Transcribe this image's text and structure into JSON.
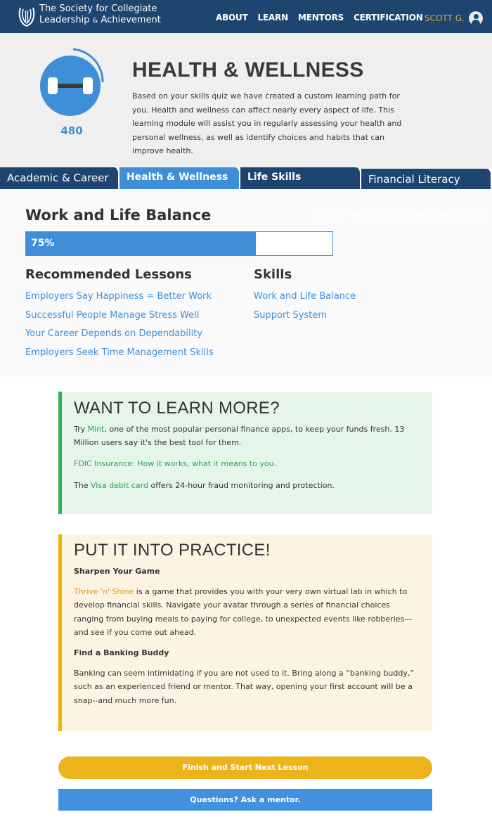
{
  "header": {
    "org_line1": "The Society for Collegiate",
    "org_line2": "Leadership",
    "org_amp": "&",
    "org_line2_end": "Achievement",
    "nav": [
      "ABOUT",
      "LEARN",
      "MENTORS",
      "CERTIFICATION"
    ],
    "user_name": "SCOTT G.",
    "brand_color": "#1e4470"
  },
  "hero": {
    "score": "480",
    "title": "HEALTH & WELLNESS",
    "description": "Based on your skills quiz we have created a custom learning path for you. Health and wellness can affect nearly every aspect of life. This learning module will assist you in regularly assessing your health and personal wellness, as well as identify choices and habits that can improve health.",
    "icon": "dumbbell-icon",
    "accent_color": "#3e8fd8"
  },
  "tabs": [
    {
      "label": "Academic & Career"
    },
    {
      "label": "Health & Wellness"
    },
    {
      "label": "Life Skills"
    },
    {
      "label": "Financial Literacy"
    }
  ],
  "skill_panel": {
    "title": "Work and Life Balance",
    "ghost_links": "Privacy Policy | Terms of Use | Contact | FAQ",
    "progress_label": "75%",
    "progress_value": 0.75,
    "lessons_title": "Recommended Lessons",
    "lessons": [
      "Employers Say Happiness = Better Work",
      "Successful People Manage Stress Well",
      "Your Career Depends on Dependability",
      "Employers Seek Time Management Skills"
    ],
    "skills_title": "Skills",
    "skills": [
      "Work and Life Balance",
      "Support System"
    ]
  },
  "learn_more": {
    "title": "WANT TO LEARN MORE?",
    "p1_pre": "Try ",
    "p1_link": "Mint",
    "p1_post": ", one of the most popular personal finance apps, to keep your funds fresh. 13 Million users say it's the best tool for them.",
    "p2_link": "FDIC Insurance: How it works, what it means to you.",
    "p3_pre": "The ",
    "p3_link": "Visa debit card",
    "p3_post": " offers 24-hour fraud monitoring and protection.",
    "accent_color": "#2fb457"
  },
  "practice": {
    "title": "PUT IT INTO PRACTICE!",
    "sub1": "Sharpen Your Game",
    "para1_link": "Thrive 'n' Shine",
    "para1_post": " is a game that provides you with your very own virtual lab in which to develop financial skills. Navigate your avatar through a series of financial choices ranging from buying meals to paying for college, to unexpected events like robberies—and see if you come out ahead.",
    "sub2": "Find a Banking Buddy",
    "para2": "Banking can seem intimidating if you are not used to it. Bring along a “banking buddy,” such as an experienced friend or mentor. That way, opening your first account will be a snap--and much more fun.",
    "accent_color": "#f0b400"
  },
  "actions": {
    "finish_label": "Finish and Start Next Lesson",
    "ask_label": "Questions? Ask a mentor."
  }
}
